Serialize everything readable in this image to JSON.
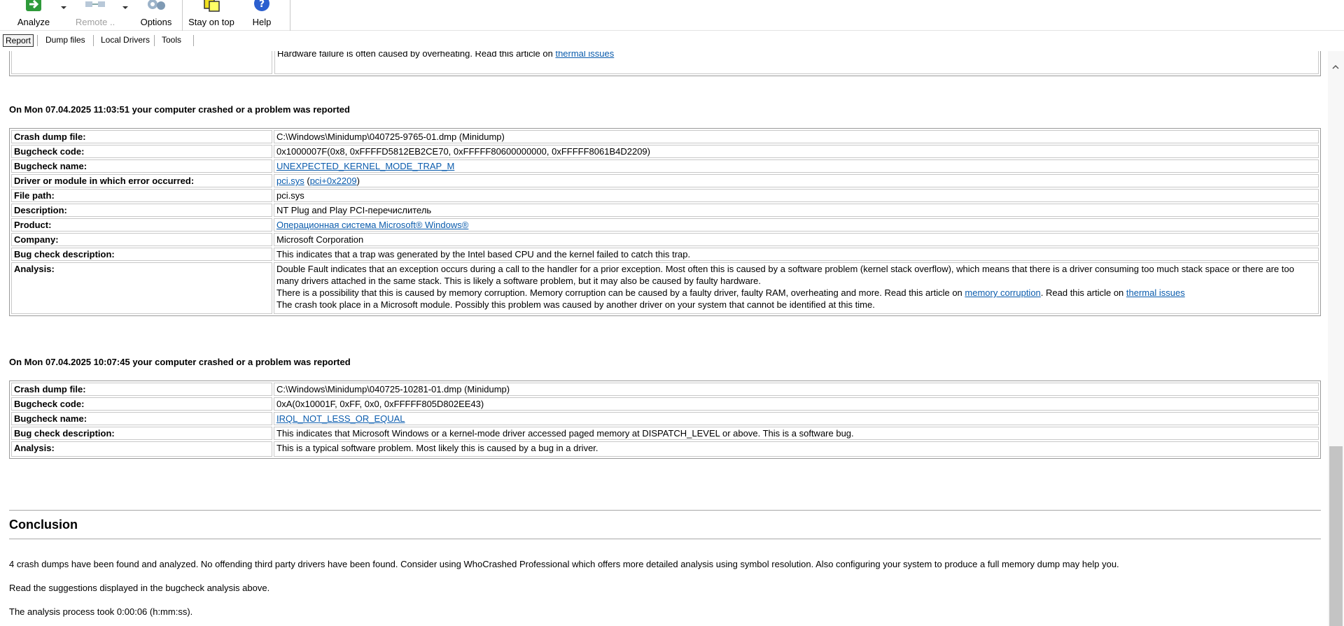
{
  "toolbar": {
    "analyze": "Analyze",
    "remote": "Remote ..",
    "options": "Options",
    "stay_on_top": "Stay on top",
    "help": "Help"
  },
  "tabs": [
    "Report",
    "Dump files",
    "Local Drivers",
    "Tools"
  ],
  "top_partial": {
    "text": "Hardware failure is often caused by overheating. Read this article on ",
    "link": "thermal issues"
  },
  "crash1": {
    "heading": "On Mon 07.04.2025 11:03:51 your computer crashed or a problem was reported",
    "labels": {
      "dump": "Crash dump file:",
      "code": "Bugcheck code:",
      "name": "Bugcheck name:",
      "driver": "Driver or module in which error occurred:",
      "path": "File path:",
      "desc": "Description:",
      "product": "Product:",
      "company": "Company:",
      "bcdesc": "Bug check description:",
      "analysis": "Analysis:"
    },
    "dump": "C:\\Windows\\Minidump\\040725-9765-01.dmp (Minidump)",
    "code": "0x1000007F(0x8, 0xFFFFD5812EB2CE70, 0xFFFFF80600000000, 0xFFFFF8061B4D2209)",
    "name": "UNEXPECTED_KERNEL_MODE_TRAP_M",
    "driver_link1": "pci.sys",
    "driver_open": " (",
    "driver_link2": "pci+0x2209",
    "driver_close": ")",
    "path": "pci.sys",
    "desc": "NT Plug and Play PCI-перечислитель",
    "product": "Операционная система Microsoft® Windows®",
    "company": "Microsoft Corporation",
    "bcdesc": "This indicates that a trap was generated by the Intel based CPU and the kernel failed to catch this trap.",
    "analysis_l1": "Double Fault indicates that an exception occurs during a call to the handler for a prior exception. Most often this is caused by a software problem (kernel stack overflow), which means that there is a driver consuming too much stack space or there are too",
    "analysis_l2": "many drivers attached in the same stack. This is likely a software problem, but it may also be caused by faulty hardware.",
    "analysis_l3a": "There is a possibility that this is caused by memory corruption. Memory corruption can be caused by a faulty driver, faulty RAM, overheating and more. Read this article on ",
    "analysis_l3_link1": "memory corruption",
    "analysis_l3b": ". Read this article on ",
    "analysis_l3_link2": "thermal issues",
    "analysis_l4": "The crash took place in a Microsoft module. Possibly this problem was caused by another driver on your system that cannot be identified at this time."
  },
  "crash2": {
    "heading": "On Mon 07.04.2025 10:07:45 your computer crashed or a problem was reported",
    "labels": {
      "dump": "Crash dump file:",
      "code": "Bugcheck code:",
      "name": "Bugcheck name:",
      "bcdesc": "Bug check description:",
      "analysis": "Analysis:"
    },
    "dump": "C:\\Windows\\Minidump\\040725-10281-01.dmp (Minidump)",
    "code": "0xA(0x10001F, 0xFF, 0x0, 0xFFFFF805D802EE43)",
    "name": "IRQL_NOT_LESS_OR_EQUAL",
    "bcdesc": "This indicates that Microsoft Windows or a kernel-mode driver accessed paged memory at DISPATCH_LEVEL or above. This is a software bug.",
    "analysis": "This is a typical software problem. Most likely this is caused by a bug in a driver."
  },
  "conclusion": {
    "title": "Conclusion",
    "p1": "4 crash dumps have been found and analyzed. No offending third party drivers have been found. Consider using WhoCrashed Professional which offers more detailed analysis using symbol resolution. Also configuring your system to produce a full memory dump may help you.",
    "p2": "Read the suggestions displayed in the bugcheck analysis above.",
    "p3": "The analysis process took 0:00:06 (h:mm:ss)."
  },
  "colors": {
    "link": "#0b5cad",
    "analyze_icon": "#2e9a3a",
    "help_icon": "#2b5fcf",
    "stay_icon": "#f0e020"
  },
  "icons": [
    "analyze-icon",
    "remote-icon",
    "options-icon",
    "stay-on-top-icon",
    "help-icon",
    "scroll-up-icon"
  ]
}
